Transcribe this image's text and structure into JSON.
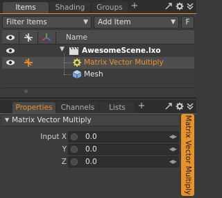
{
  "top": {
    "tabs": [
      {
        "label": "Items",
        "active": true
      },
      {
        "label": "Shading",
        "active": false
      },
      {
        "label": "Groups",
        "active": false
      }
    ],
    "add_tab": "+",
    "filter_label": "Filter Items",
    "add_item_label": "Add Item",
    "f_button": "F",
    "name_header": "Name",
    "tree": [
      {
        "label": "AwesomeScene.lxo",
        "type": "scene",
        "expanded": true
      },
      {
        "label": "Matrix Vector Multiply",
        "type": "channel-modifier",
        "selected": true
      },
      {
        "label": "Mesh",
        "type": "mesh"
      }
    ]
  },
  "bottom": {
    "tabs": [
      {
        "label": "Properties",
        "active": true
      },
      {
        "label": "Channels",
        "active": false
      },
      {
        "label": "Lists",
        "active": false
      }
    ],
    "add_tab": "+",
    "section_title": "Matrix Vector Multiply",
    "props": [
      {
        "label": "Input X",
        "value": "0.0"
      },
      {
        "label": "Y",
        "value": "0.0"
      },
      {
        "label": "Z",
        "value": "0.0"
      }
    ],
    "side_tab_label": "Matrix Vector Multiply"
  },
  "colors": {
    "accent": "#e8932a",
    "selection": "#4e4e4e",
    "panel": "#3c3c3c"
  }
}
